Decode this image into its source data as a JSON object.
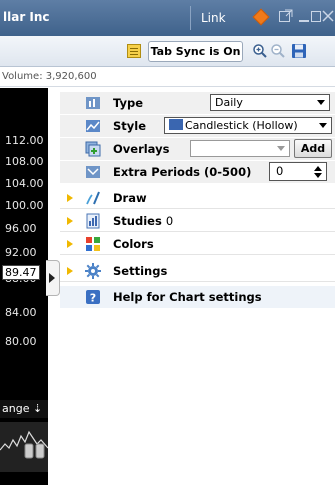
{
  "window": {
    "title": "llar Inc",
    "link_label": "Link",
    "colors": {
      "titlebar": "#3f628b",
      "link_diamond": "#f07a1a"
    }
  },
  "toolbar": {
    "tab_sync_label": "Tab Sync is On"
  },
  "chart": {
    "volume_text": "Volume: 3,920,600",
    "price_labels": [
      "112.00",
      "108.00",
      "104.00",
      "100.00",
      "96.00",
      "92.00",
      "88.00",
      "84.00",
      "80.00"
    ],
    "highlight_price": "89.47",
    "range_label": "ange ⇣"
  },
  "panel": {
    "type": {
      "label": "Type",
      "value": "Daily"
    },
    "style": {
      "label": "Style",
      "value": "Candlestick (Hollow)"
    },
    "overlays": {
      "label": "Overlays",
      "value": "",
      "add_label": "Add"
    },
    "extra_periods": {
      "label": "Extra Periods (0-500)",
      "value": "0"
    },
    "draw": {
      "label": "Draw"
    },
    "studies": {
      "label": "Studies",
      "count": "0"
    },
    "colors": {
      "label": "Colors"
    },
    "settings": {
      "label": "Settings"
    },
    "help": {
      "label": "Help for Chart settings"
    }
  }
}
